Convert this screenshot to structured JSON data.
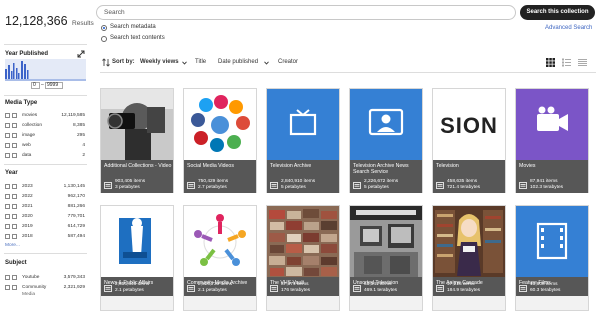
{
  "results": {
    "count": "12,128,366",
    "word": "Results"
  },
  "search": {
    "placeholder": "Search",
    "button": "Search this collection",
    "options": [
      "Search metadata",
      "Search text contents"
    ],
    "advanced": "Advanced Search"
  },
  "year_published": {
    "title": "Year Published",
    "from": "0",
    "to": "9999"
  },
  "facets": {
    "media_type": {
      "title": "Media Type",
      "items": [
        {
          "label": "movies",
          "count": "12,119,585"
        },
        {
          "label": "collection",
          "count": "8,385"
        },
        {
          "label": "image",
          "count": "295"
        },
        {
          "label": "web",
          "count": "4"
        },
        {
          "label": "data",
          "count": "2"
        }
      ]
    },
    "year": {
      "title": "Year",
      "items": [
        {
          "label": "2023",
          "count": "1,130,145"
        },
        {
          "label": "2022",
          "count": "962,170"
        },
        {
          "label": "2021",
          "count": "881,266"
        },
        {
          "label": "2020",
          "count": "779,701"
        },
        {
          "label": "2019",
          "count": "614,729"
        },
        {
          "label": "2018",
          "count": "587,494"
        }
      ],
      "more": "More..."
    },
    "subject": {
      "title": "Subject",
      "items": [
        {
          "label": "Youtube",
          "count": "3,579,343"
        },
        {
          "label": "Community",
          "count": "2,321,929"
        }
      ],
      "item2_sub": "Media"
    }
  },
  "sort": {
    "label": "Sort by:",
    "active": "Weekly views",
    "options": [
      "Title",
      "Date published",
      "Creator"
    ]
  },
  "tiles": [
    {
      "title": "Additional Collections - Video",
      "items": "903,405 items",
      "size": "3 petabytes"
    },
    {
      "title": "Social Media Videos",
      "items": "750,429 items",
      "size": "2.7 petabytes"
    },
    {
      "title": "Television Archive",
      "items": "2,840,910 items",
      "size": "5 petabytes"
    },
    {
      "title": "Television Archive News Search Service",
      "items": "2,226,672 items",
      "size": "5 petabytes"
    },
    {
      "title": "Television",
      "items": "458,635 items",
      "size": "721.4 terabytes"
    },
    {
      "title": "Movies",
      "items": "87,941 items",
      "size": "102.3 terabytes"
    },
    {
      "title": "News & Public Affairs",
      "items": "2,656,846 items",
      "size": "2.1 petabytes"
    },
    {
      "title": "Community Media Archive",
      "items": "2,520,739 items",
      "size": "2.1 petabytes"
    },
    {
      "title": "The VHS Vault",
      "items": "87,374 items",
      "size": "176 terabytes"
    },
    {
      "title": "Unsorted Television",
      "items": "61,341 items",
      "size": "469.1 terabytes"
    },
    {
      "title": "The Anime Cascade",
      "items": "47,216 items",
      "size": "184.9 terabytes"
    },
    {
      "title": "Feature Films",
      "items": "15,808 items",
      "size": "60.3 terabytes"
    }
  ],
  "thumbnail_text": {
    "sion": "SION"
  },
  "colors": {
    "accent": "#3b7ddd",
    "tile_band": "#575757",
    "movies_purple": "#7b55c7",
    "search_button": "#222222"
  }
}
